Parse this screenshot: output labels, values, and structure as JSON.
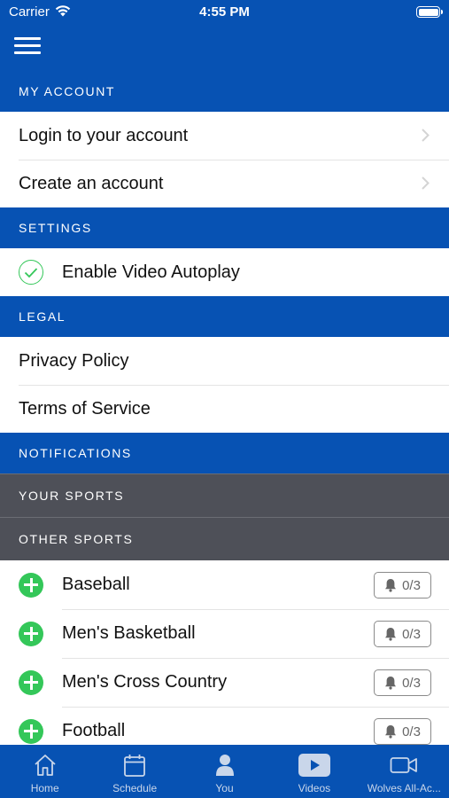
{
  "status_bar": {
    "carrier": "Carrier",
    "time": "4:55 PM"
  },
  "sections": {
    "my_account": "MY ACCOUNT",
    "settings": "SETTINGS",
    "legal": "LEGAL",
    "notifications": "NOTIFICATIONS",
    "your_sports": "YOUR SPORTS",
    "other_sports": "OTHER SPORTS"
  },
  "account": {
    "login": "Login to your account",
    "create": "Create an account"
  },
  "settings": {
    "autoplay": "Enable Video Autoplay"
  },
  "legal": {
    "privacy": "Privacy Policy",
    "terms": "Terms of Service"
  },
  "sports": [
    {
      "name": "Baseball",
      "count": "0/3"
    },
    {
      "name": "Men's Basketball",
      "count": "0/3"
    },
    {
      "name": "Men's Cross Country",
      "count": "0/3"
    },
    {
      "name": "Football",
      "count": "0/3"
    }
  ],
  "tabs": [
    {
      "label": "Home",
      "icon": "home-icon"
    },
    {
      "label": "Schedule",
      "icon": "calendar-icon"
    },
    {
      "label": "You",
      "icon": "person-icon"
    },
    {
      "label": "Videos",
      "icon": "play-icon"
    },
    {
      "label": "Wolves All-Ac...",
      "icon": "video-camera-icon"
    }
  ],
  "colors": {
    "brand_blue": "#0752b3",
    "section_gray": "#4e5058",
    "accent_green": "#34c759"
  }
}
